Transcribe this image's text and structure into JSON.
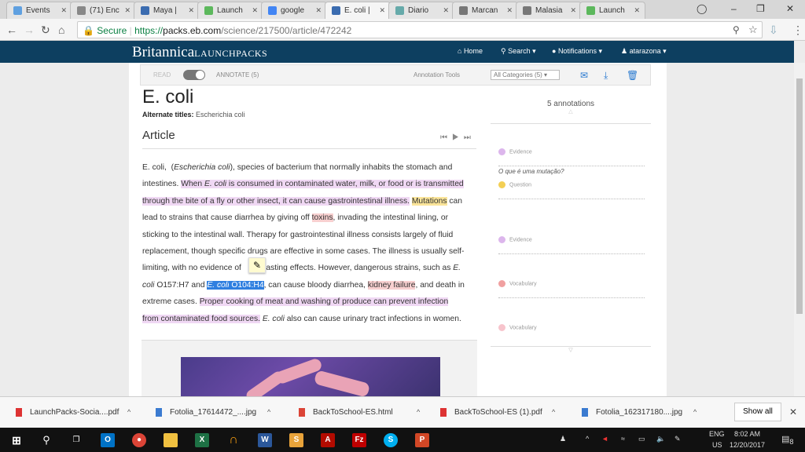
{
  "browser": {
    "tabs": [
      {
        "label": "Events",
        "color": "#5fa0e0"
      },
      {
        "label": "(71) Enc",
        "color": "#888"
      },
      {
        "label": "Maya |",
        "color": "#3b6cb0"
      },
      {
        "label": "Launch",
        "color": "#5cb85c"
      },
      {
        "label": "google",
        "color": "#4285f4"
      },
      {
        "label": "E. coli |",
        "color": "#3b6cb0",
        "active": true
      },
      {
        "label": "Diario",
        "color": "#6aa"
      },
      {
        "label": "Marcan",
        "color": "#777"
      },
      {
        "label": "Malasia",
        "color": "#777"
      },
      {
        "label": "Launch",
        "color": "#5cb85c"
      }
    ],
    "secure_label": "Secure",
    "url_scheme": "https://",
    "url_host": "packs.eb.com",
    "url_path": "/science/217500/article/472242"
  },
  "site": {
    "logo": "Britannica",
    "logo_sub": "LAUNCHPACKS",
    "nav": {
      "home": "Home",
      "search": "Search",
      "notifications": "Notifications",
      "user": "atarazona"
    },
    "brand_color": "#0d3f60"
  },
  "toolbar": {
    "read": "READ",
    "annotate": "ANNOTATE (5)",
    "tools": "Annotation Tools",
    "category": "All Categories (5)"
  },
  "article": {
    "title": "E. coli",
    "alt_label": "Alternate titles:",
    "alt_value": "Escherichia coli",
    "section": "Article",
    "lines": [
      [
        {
          "t": "E. coli,  ("
        },
        {
          "t": "Escherichia coli",
          "c": "it"
        },
        {
          "t": "), species of bacterium that normally inhabits the stomach and"
        }
      ],
      [
        {
          "t": "intestines. "
        },
        {
          "t": "When ",
          "c": "ev"
        },
        {
          "t": "E. coli",
          "c": "ev it"
        },
        {
          "t": " is consumed in contaminated water, milk, or food or is transmitted",
          "c": "ev"
        }
      ],
      [
        {
          "t": "through the bite of a fly or other insect, it can cause gastrointestinal illness.",
          "c": "ev"
        },
        {
          "t": " "
        },
        {
          "t": "Mutations",
          "c": "qu"
        },
        {
          "t": " can"
        }
      ],
      [
        {
          "t": "lead to strains that cause diarrhea by giving off "
        },
        {
          "t": "toxins",
          "c": "vo"
        },
        {
          "t": ", invading the intestinal lining, or"
        }
      ],
      [
        {
          "t": "sticking to the intestinal wall. Therapy for gastrointestinal illness consists largely of fluid"
        }
      ],
      [
        {
          "t": "replacement, though specific drugs are effective in some cases. The illness is usually self-"
        }
      ],
      [
        {
          "t": "limiting, with no evidence of         -lasting effects. However, dangerous strains, such as "
        },
        {
          "t": "E.",
          "c": "it"
        }
      ],
      [
        {
          "t": "coli",
          "c": "it"
        },
        {
          "t": " O157:H7 and "
        },
        {
          "t": "E. coli",
          "c": "sel it"
        },
        {
          "t": " O104:H4",
          "c": "sel"
        },
        {
          "t": ", can cause bloody diarrhea, "
        },
        {
          "t": "kidney failure",
          "c": "vo"
        },
        {
          "t": ", and death in"
        }
      ],
      [
        {
          "t": "extreme cases. "
        },
        {
          "t": "Proper cooking of meat and washing of produce can prevent infection",
          "c": "ev"
        }
      ],
      [
        {
          "t": "from contaminated food sources.",
          "c": "ev"
        },
        {
          "t": " "
        },
        {
          "t": "E. coli",
          "c": "it"
        },
        {
          "t": " also can cause urinary tract infections in women."
        }
      ]
    ]
  },
  "annotations": {
    "header": "5 annotations",
    "items": [
      {
        "label": "Evidence",
        "color": "#dcb6ec"
      },
      {
        "label": "Question",
        "color": "#f3cf54",
        "note": "O que é uma mutação?"
      },
      {
        "label": "Evidence",
        "color": "#dcb6ec"
      },
      {
        "label": "Vocabulary",
        "color": "#f0a0a0"
      },
      {
        "label": "Vocabulary",
        "color": "#f7c4cc"
      }
    ]
  },
  "downloads": {
    "items": [
      "LaunchPacks-Socia....pdf",
      "Fotolia_17614472_....jpg",
      "BackToSchool-ES.html",
      "BackToSchool-ES (1).pdf",
      "Fotolia_162317180....jpg"
    ],
    "show_all": "Show all"
  },
  "taskbar": {
    "lang": "ENG",
    "region": "US",
    "time": "8:02 AM",
    "date": "12/20/2017",
    "notif_count": "8"
  }
}
